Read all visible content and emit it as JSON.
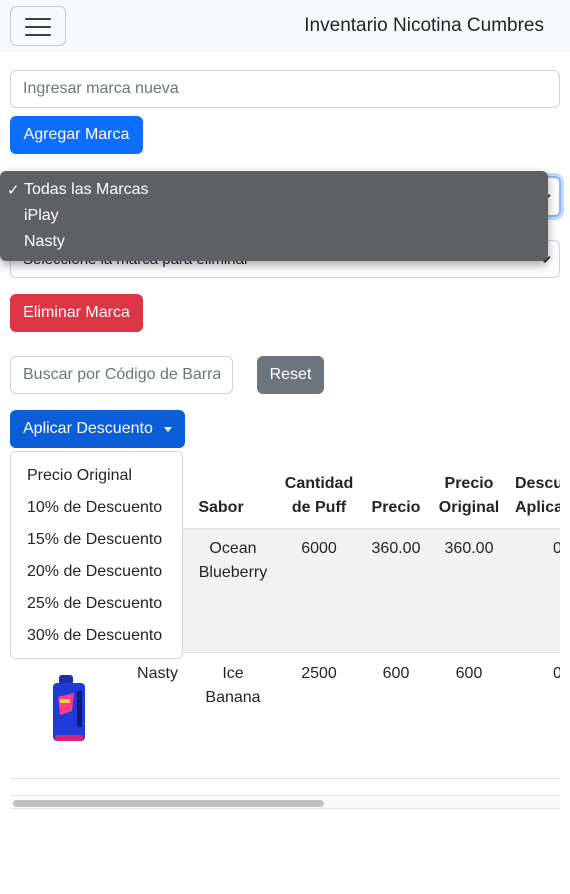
{
  "navbar": {
    "brand": "Inventario Nicotina Cumbres"
  },
  "brand_form": {
    "input_placeholder": "Ingresar marca nueva",
    "add_label": "Agregar Marca"
  },
  "filter_select": {
    "options": [
      {
        "label": "Todas las Marcas",
        "selected": true
      },
      {
        "label": "iPlay",
        "selected": false
      },
      {
        "label": "Nasty",
        "selected": false
      }
    ]
  },
  "delete_form": {
    "select_placeholder": "Seleccione la marca para eliminar",
    "delete_label": "Eliminar Marca"
  },
  "search": {
    "placeholder": "Buscar por Código de Barras",
    "reset_label": "Reset"
  },
  "discount": {
    "button_label": "Aplicar Descuento",
    "options": [
      "Precio Original",
      "10% de Descuento",
      "15% de Descuento",
      "20% de Descuento",
      "25% de Descuento",
      "30% de Descuento"
    ]
  },
  "table": {
    "headers": {
      "sabor": "Sabor",
      "puff": [
        "Cantidad",
        "de Puff"
      ],
      "precio": "Precio",
      "original": [
        "Precio",
        "Original"
      ],
      "descuento": [
        "Descuento",
        "Aplicado"
      ]
    },
    "rows": [
      {
        "marca": "",
        "sabor": [
          "Ocean",
          "Blueberry"
        ],
        "puff": "6000",
        "precio": "360.00",
        "original": "360.00",
        "descuento": "0"
      },
      {
        "marca": "Nasty",
        "sabor": [
          "Ice",
          "Banana"
        ],
        "puff": "2500",
        "precio": "600",
        "original": "600",
        "descuento": "0"
      }
    ]
  },
  "colors": {
    "primary": "#0d6efd",
    "danger": "#dc3545",
    "secondary": "#6c757d",
    "navbar_bg": "#f8f9fa"
  },
  "icons": {
    "menu": "hamburger-icon",
    "product": "vape-device-image",
    "check": "check-icon"
  }
}
